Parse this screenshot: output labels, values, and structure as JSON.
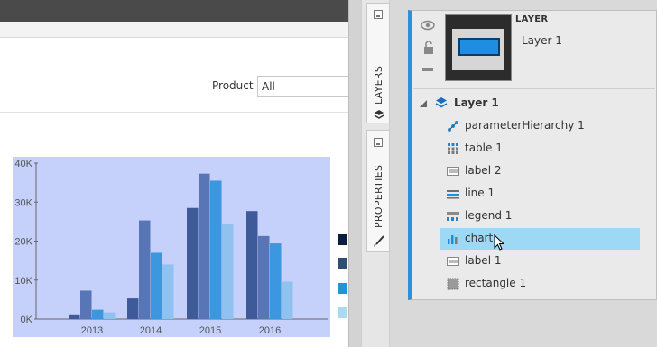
{
  "filter": {
    "label": "Product",
    "value": "All"
  },
  "chart_data": {
    "type": "bar",
    "categories": [
      "2013",
      "2014",
      "2015",
      "2016"
    ],
    "series": [
      {
        "values": [
          1200,
          5300,
          28500,
          27700
        ]
      },
      {
        "values": [
          7300,
          25300,
          37300,
          21300
        ]
      },
      {
        "values": [
          2400,
          17000,
          35500,
          19400
        ]
      },
      {
        "values": [
          1700,
          14000,
          24400,
          9600
        ]
      }
    ],
    "y_ticks": [
      "40K",
      "30K",
      "20K",
      "10K",
      "0K"
    ],
    "ylim": [
      0,
      40000
    ],
    "colors": [
      "#3f5a98",
      "#5875b5",
      "#3c96e0",
      "#8fc2ef"
    ],
    "grid": false
  },
  "legend_colors": [
    "#0b1e3f",
    "#2f4e74",
    "#1f96d2",
    "#a8dbf2"
  ],
  "tabs": {
    "layers": "LAYERS",
    "properties": "PROPERTIES"
  },
  "layer_panel": {
    "heading": "LAYER",
    "layer_name": "Layer 1",
    "tree_root": "Layer 1",
    "items": [
      {
        "label": "parameterHierarchy 1",
        "icon": "hierarchy-icon"
      },
      {
        "label": "table 1",
        "icon": "table-icon"
      },
      {
        "label": "label 2",
        "icon": "label-icon"
      },
      {
        "label": "line 1",
        "icon": "line-icon"
      },
      {
        "label": "legend 1",
        "icon": "legend-icon"
      },
      {
        "label": "chart",
        "icon": "chart-icon",
        "selected": true
      },
      {
        "label": "label 1",
        "icon": "label-icon"
      },
      {
        "label": "rectangle 1",
        "icon": "rectangle-icon"
      }
    ]
  },
  "accent_color": "#2f8fd8",
  "selection_color": "#9dd8f5"
}
